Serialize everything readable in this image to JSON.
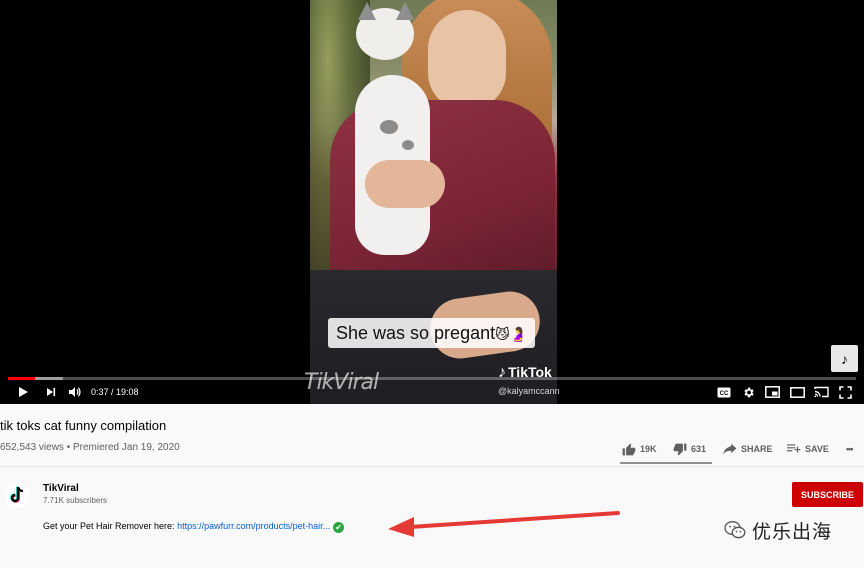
{
  "player": {
    "caption_text": "She was so pregant",
    "caption_emoji": "😼🤰",
    "watermark_left": "TikViral",
    "watermark_brand": "TikTok",
    "watermark_handle": "@kalyamccann",
    "corner_logo_icon": "tiktok-note-icon",
    "current_time": "0:37",
    "duration": "19:08",
    "time_display": "0:37 / 19:08",
    "progress_fraction": 0.0322,
    "buffer_fraction": 0.065,
    "icons": {
      "play": "play-icon",
      "next": "next-icon",
      "volume": "volume-icon",
      "cc": "closed-captions-icon",
      "settings": "gear-icon",
      "miniplayer": "miniplayer-icon",
      "theater": "theater-mode-icon",
      "cast": "cast-icon",
      "fullscreen": "fullscreen-icon"
    },
    "cc_label": "CC"
  },
  "video": {
    "title": "tik toks cat funny compilation",
    "meta": "652,543 views • Premiered Jan 19, 2020"
  },
  "actions": {
    "like_count": "19K",
    "dislike_count": "631",
    "share_label": "SHARE",
    "save_label": "SAVE",
    "more_label": "•••"
  },
  "channel": {
    "name": "TikViral",
    "subscribers": "7.71K subscribers",
    "subscribe_label": "SUBSCRIBE"
  },
  "description": {
    "text": "Get your Pet Hair Remover here: ",
    "link": "https://pawfurr.com/products/pet-hair...",
    "check": "✔"
  },
  "overlay": {
    "wechat_label": "优乐出海"
  },
  "colors": {
    "accent_red": "#cc0000",
    "progress_red": "#ff0000",
    "link_blue": "#065fd4",
    "arrow_red": "#e53935",
    "verified_green": "#2ba640"
  }
}
